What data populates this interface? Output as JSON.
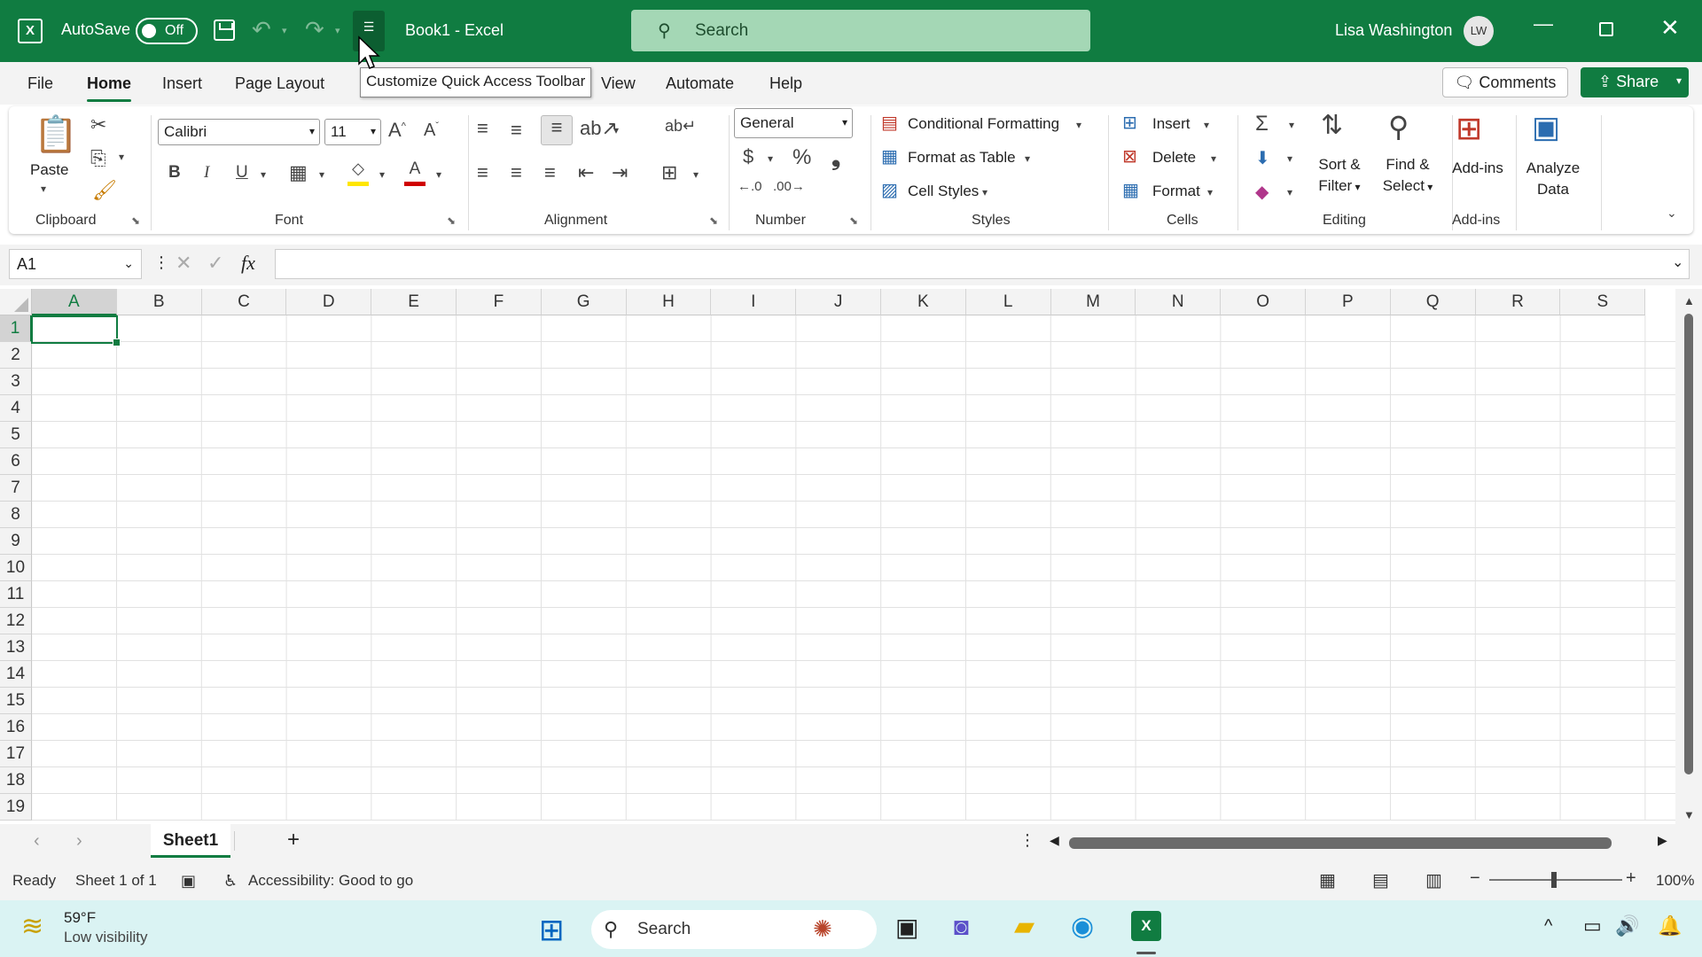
{
  "titlebar": {
    "autosave_label": "AutoSave",
    "autosave_state": "Off",
    "document_title": "Book1  -  Excel",
    "search_placeholder": "Search",
    "user_name": "Lisa Washington",
    "user_initials": "LW",
    "accent_color": "#107c41"
  },
  "menu": {
    "tabs": [
      "File",
      "Home",
      "Insert",
      "Page Layout",
      "View",
      "Automate",
      "Help"
    ],
    "active_tab": "Home",
    "tooltip": "Customize Quick Access Toolbar",
    "comments_label": "Comments",
    "share_label": "Share"
  },
  "ribbon": {
    "clipboard": {
      "paste_label": "Paste",
      "group_label": "Clipboard"
    },
    "font": {
      "font_name": "Calibri",
      "font_size": "11",
      "group_label": "Font"
    },
    "alignment": {
      "group_label": "Alignment"
    },
    "number": {
      "format": "General",
      "group_label": "Number"
    },
    "styles": {
      "conditional_formatting": "Conditional Formatting",
      "format_as_table": "Format as Table",
      "cell_styles": "Cell Styles",
      "group_label": "Styles"
    },
    "cells": {
      "insert": "Insert",
      "delete": "Delete",
      "format": "Format",
      "group_label": "Cells"
    },
    "editing": {
      "sort_filter_1": "Sort &",
      "sort_filter_2": "Filter",
      "find_select_1": "Find &",
      "find_select_2": "Select",
      "group_label": "Editing"
    },
    "addins": {
      "addins_label": "Add-ins",
      "group_label": "Add-ins"
    },
    "analyze": {
      "line1": "Analyze",
      "line2": "Data"
    }
  },
  "formula_bar": {
    "name_box": "A1",
    "formula": ""
  },
  "grid": {
    "columns": [
      "A",
      "B",
      "C",
      "D",
      "E",
      "F",
      "G",
      "H",
      "I",
      "J",
      "K",
      "L",
      "M",
      "N",
      "O",
      "P",
      "Q",
      "R",
      "S"
    ],
    "rows": [
      "1",
      "2",
      "3",
      "4",
      "5",
      "6",
      "7",
      "8",
      "9",
      "10",
      "11",
      "12",
      "13",
      "14",
      "15",
      "16",
      "17",
      "18",
      "19"
    ],
    "selected_cell": "A1"
  },
  "sheets": {
    "tabs": [
      "Sheet1"
    ]
  },
  "statusbar": {
    "ready": "Ready",
    "sheet_info": "Sheet 1 of 1",
    "accessibility": "Accessibility: Good to go",
    "zoom": "100%"
  },
  "taskbar": {
    "weather_temp": "59°F",
    "weather_desc": "Low visibility",
    "search_label": "Search"
  }
}
